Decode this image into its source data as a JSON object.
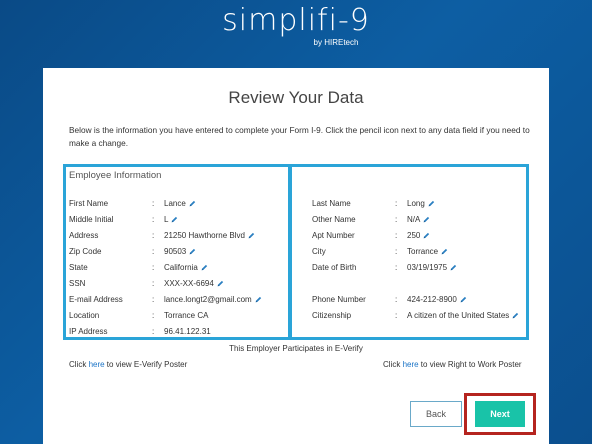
{
  "brand": {
    "logo": "simplifi-9",
    "byline": "by HIREtech"
  },
  "page": {
    "title": "Review Your Data",
    "intro": "Below is the information you have entered to complete your Form I-9. Click the pencil icon next to any data field if you need to make a change."
  },
  "employee_section_title": "Employee Information",
  "left_fields": [
    {
      "label": "First Name",
      "value": "Lance",
      "editable": true
    },
    {
      "label": "Middle Initial",
      "value": "L",
      "editable": true
    },
    {
      "label": "Address",
      "value": "21250 Hawthorne Blvd",
      "editable": true
    },
    {
      "label": "Zip Code",
      "value": "90503",
      "editable": true
    },
    {
      "label": "State",
      "value": "California",
      "editable": true
    },
    {
      "label": "SSN",
      "value": "XXX-XX-6694",
      "editable": true
    },
    {
      "label": "E-mail Address",
      "value": "lance.longt2@gmail.com",
      "editable": true
    },
    {
      "label": "Location",
      "value": "Torrance CA",
      "editable": false
    },
    {
      "label": "IP Address",
      "value": "96.41.122.31",
      "editable": false
    }
  ],
  "right_fields": [
    {
      "label": "Last Name",
      "value": "Long",
      "editable": true
    },
    {
      "label": "Other Name",
      "value": "N/A",
      "editable": true
    },
    {
      "label": "Apt Number",
      "value": "250",
      "editable": true
    },
    {
      "label": "City",
      "value": "Torrance",
      "editable": true
    },
    {
      "label": "Date of Birth",
      "value": "03/19/1975",
      "editable": true
    },
    {
      "label": "Phone Number",
      "value": "424-212-8900",
      "editable": true
    },
    {
      "label": "Citizenship",
      "value": "A citizen of the United States",
      "editable": true
    }
  ],
  "separator": ":",
  "participates_text": "This Employer Participates in E-Verify",
  "everify_poster": {
    "prefix": "Click ",
    "link": "here",
    "suffix": " to view E-Verify Poster"
  },
  "rtw_poster": {
    "prefix": "Click ",
    "link": "here",
    "suffix": " to view Right to Work Poster"
  },
  "buttons": {
    "back": "Back",
    "next": "Next"
  },
  "colors": {
    "accent_box": "#2aa4d8",
    "next_button": "#19c3a8",
    "highlight": "#b5241f",
    "link": "#1a73c6"
  }
}
